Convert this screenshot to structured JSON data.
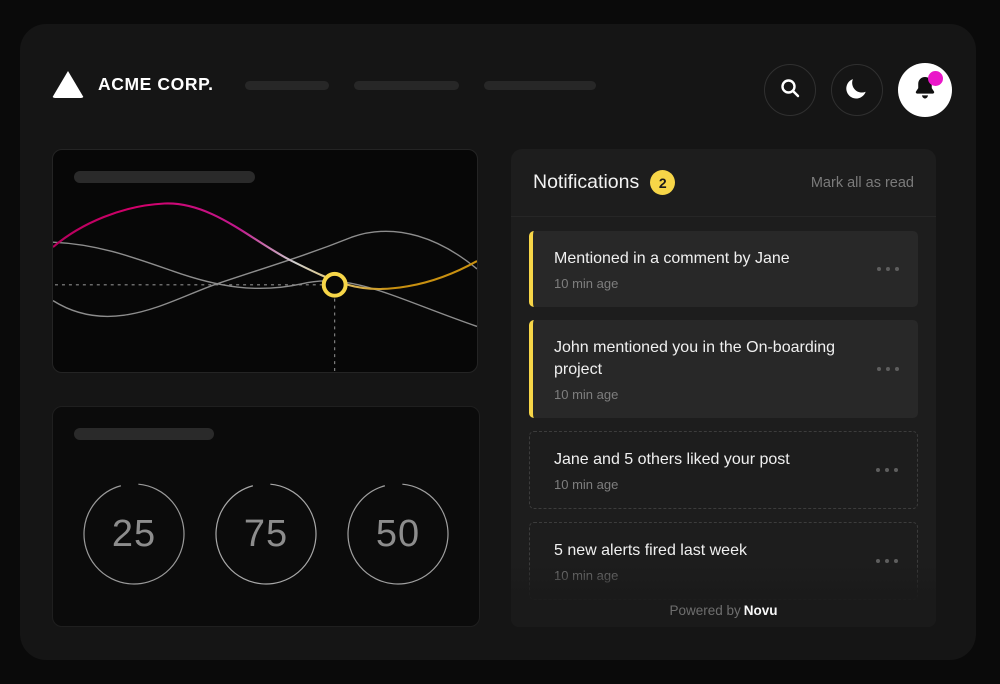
{
  "brand": {
    "logo_icon": "triangle-logo-icon",
    "name": "ACME CORP."
  },
  "header": {
    "nav_placeholders": 3,
    "actions": [
      {
        "name": "search-icon",
        "label": "Search"
      },
      {
        "name": "moon-icon",
        "label": "Dark mode"
      },
      {
        "name": "bell-icon",
        "label": "Notifications",
        "badge_color": "#ea17c9"
      }
    ]
  },
  "chart_card": {
    "skeleton_title": ""
  },
  "chart_data": {
    "type": "line",
    "title": "",
    "xlabel": "",
    "ylabel": "",
    "grid": false,
    "legend": "none",
    "marker": {
      "x": 0.66,
      "y": 0.56,
      "color": "#f7d648",
      "label": ""
    },
    "series": [
      {
        "name": "highlight",
        "color_start": "#cf0063",
        "color_end": "#c89010",
        "values": [
          0.42,
          0.67,
          0.76,
          0.72,
          0.58,
          0.44,
          0.38,
          0.4,
          0.47
        ]
      },
      {
        "name": "gray-a",
        "color": "#8e8e8e",
        "values": [
          0.46,
          0.38,
          0.31,
          0.3,
          0.35,
          0.47,
          0.58,
          0.62,
          0.58
        ]
      },
      {
        "name": "gray-b",
        "color": "#8e8e8e",
        "values": [
          0.28,
          0.44,
          0.56,
          0.59,
          0.55,
          0.46,
          0.34,
          0.24,
          0.19
        ]
      }
    ]
  },
  "gauges_card": {
    "skeleton_title": "",
    "gauges": [
      {
        "name": "gauge-1",
        "value": "25",
        "percent": 25
      },
      {
        "name": "gauge-2",
        "value": "75",
        "percent": 75
      },
      {
        "name": "gauge-3",
        "value": "50",
        "percent": 50
      }
    ]
  },
  "notifications": {
    "title": "Notifications",
    "unread_count": "2",
    "badge_color": "#f7d648",
    "mark_all_label": "Mark all as read",
    "items": [
      {
        "text": "Mentioned in a comment by Jane",
        "time": "10 min age",
        "state": "unread"
      },
      {
        "text": "John mentioned you in the On-boarding project",
        "time": "10 min age",
        "state": "unread"
      },
      {
        "text": "Jane and 5 others liked your post",
        "time": "10 min age",
        "state": "read"
      },
      {
        "text": "5 new alerts fired last week",
        "time": "10 min age",
        "state": "read"
      }
    ],
    "footer_prefix": "Powered by",
    "footer_brand": "Novu"
  }
}
